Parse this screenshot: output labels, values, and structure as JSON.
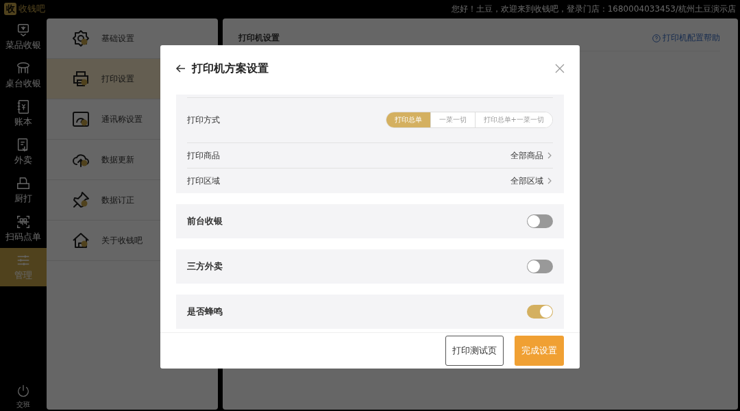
{
  "brand": {
    "mark": "收",
    "name": "收钱吧"
  },
  "greeting": "您好！土豆，欢迎来到收钱吧，登录门店：1680004033453/杭州土豆演示店",
  "nav": [
    {
      "label": "菜品收银",
      "selected": false
    },
    {
      "label": "桌台收银",
      "selected": false
    },
    {
      "label": "账本",
      "selected": false
    },
    {
      "label": "外卖",
      "selected": false
    },
    {
      "label": "厨打",
      "selected": false
    },
    {
      "label": "扫码点单",
      "selected": false
    },
    {
      "label": "管理",
      "selected": true
    }
  ],
  "shift": {
    "label": "交班"
  },
  "settings_menu": [
    {
      "label": "基础设置",
      "selected": false
    },
    {
      "label": "打印设置",
      "selected": true
    },
    {
      "label": "通讯称设置",
      "selected": false
    },
    {
      "label": "数据更新",
      "selected": false
    },
    {
      "label": "数据订正",
      "selected": false
    },
    {
      "label": "关于收钱吧",
      "selected": false
    }
  ],
  "printer_panel": {
    "title": "打印机设置",
    "help_link": "打印机配置帮助"
  },
  "dialog": {
    "title": "打印机方案设置",
    "print_mode": {
      "label": "打印方式",
      "options": [
        {
          "label": "打印总单",
          "selected": true
        },
        {
          "label": "一菜一切",
          "selected": false
        },
        {
          "label": "打印总单+一菜一切",
          "selected": false
        }
      ]
    },
    "options": [
      {
        "label": "打印商品",
        "value": "全部商品"
      },
      {
        "label": "打印区域",
        "value": "全部区域"
      }
    ],
    "toggles": [
      {
        "label": "前台收银",
        "on": false
      },
      {
        "label": "三方外卖",
        "on": false
      },
      {
        "label": "是否蜂鸣",
        "on": true
      }
    ],
    "buttons": [
      {
        "label": "打印测试页",
        "kind": "secondary"
      },
      {
        "label": "完成设置",
        "kind": "primary"
      }
    ]
  }
}
